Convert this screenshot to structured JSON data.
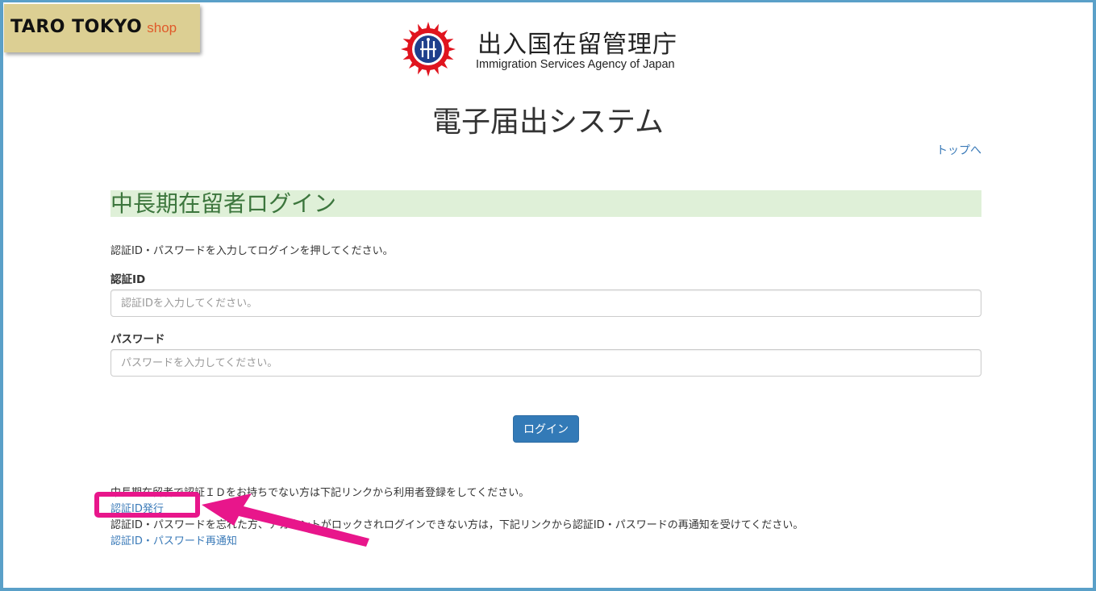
{
  "shop_badge": {
    "brand": "TARO TOKYO",
    "shop": "shop"
  },
  "header": {
    "agency_name": "出入国在留管理庁",
    "agency_name_en": "Immigration Services Agency of Japan",
    "logo_icon": "immigration-agency-emblem-icon"
  },
  "system_title": "電子届出システム",
  "top_link": "トップへ",
  "login": {
    "heading": "中長期在留者ログイン",
    "instruction": "認証ID・パスワードを入力してログインを押してください。",
    "id_label": "認証ID",
    "id_placeholder": "認証IDを入力してください。",
    "password_label": "パスワード",
    "password_placeholder": "パスワードを入力してください。",
    "button": "ログイン"
  },
  "footer": {
    "note_issue": "中長期在留者で認証ＩＤをお持ちでない方は下記リンクから利用者登録をしてください。",
    "link_issue": "認証ID発行",
    "note_renotify": "認証ID・パスワードを忘れた方、アカウントがロックされログインできない方は，下記リンクから認証ID・パスワードの再通知を受けてください。",
    "link_renotify": "認証ID・パスワード再通知"
  },
  "colors": {
    "frame": "#5aa0c8",
    "heading_bg": "#dff0d8",
    "heading_text": "#3c763d",
    "primary_button": "#337ab7",
    "link": "#3a7ab8",
    "annotation": "#e8168b"
  }
}
